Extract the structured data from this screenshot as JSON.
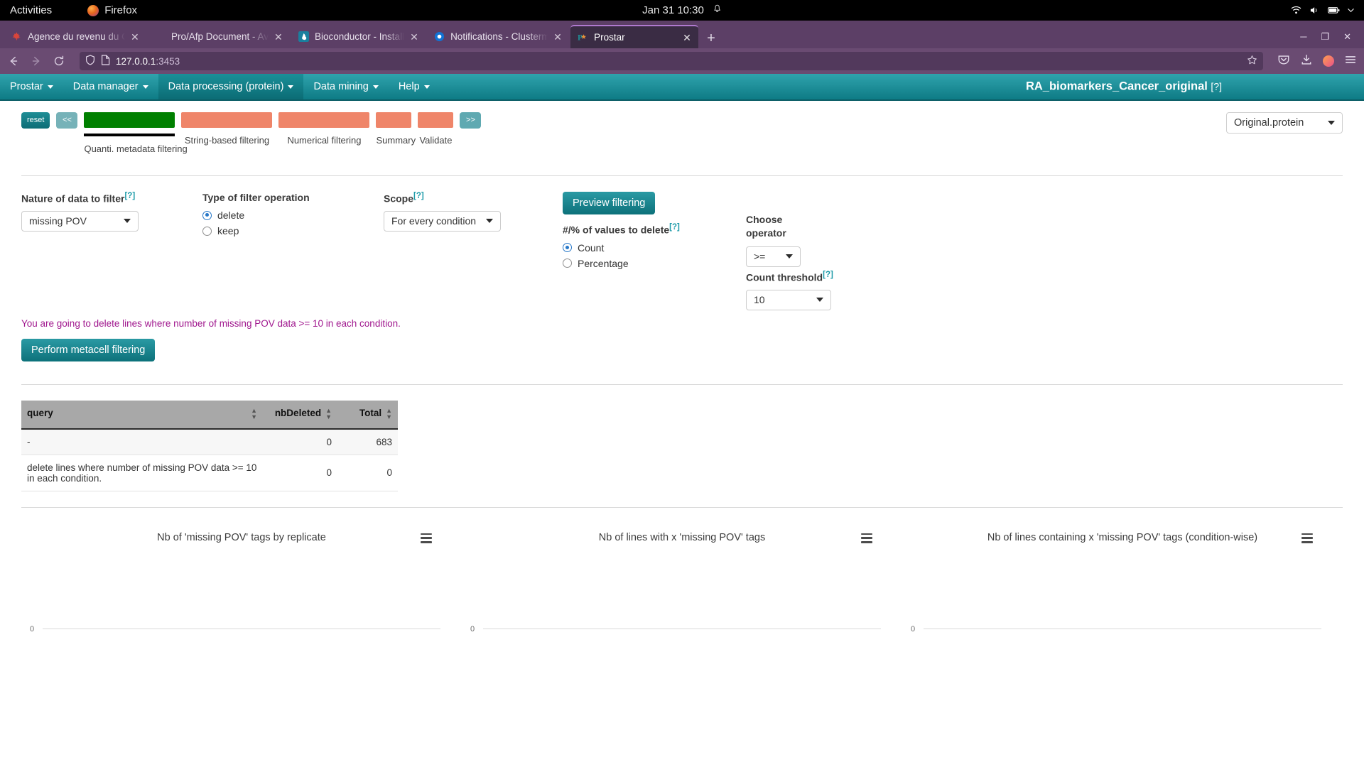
{
  "desktop": {
    "activities": "Activities",
    "app_name": "Firefox",
    "clock": "Jan 31  10:30",
    "icons": [
      "bell-icon",
      "wifi-icon",
      "volume-icon",
      "battery-icon",
      "power-menu-icon"
    ]
  },
  "browser": {
    "tabs": [
      {
        "title": "Agence du revenu du Can",
        "favicon": "maple-leaf-icon",
        "active": false
      },
      {
        "title": "Pro/Afp Document - Avis_de",
        "favicon": "blank-icon",
        "active": false
      },
      {
        "title": "Bioconductor - Install",
        "favicon": "bioconductor-icon",
        "active": false
      },
      {
        "title": "Notifications - Clusterma",
        "favicon": "notification-icon",
        "active": false
      },
      {
        "title": "Prostar",
        "favicon": "prostar-icon",
        "active": true
      }
    ],
    "new_tab_label": "+",
    "url_host": "127.0.0.1",
    "url_port": ":3453",
    "nav": {
      "back": "back-icon",
      "forward": "forward-icon",
      "reload": "reload-icon",
      "shield": "shield-icon",
      "page": "page-icon",
      "bookmark": "star-icon",
      "pocket": "pocket-icon",
      "downloads": "download-icon",
      "account": "account-icon",
      "menu": "hamburger-menu-icon"
    },
    "window_controls": {
      "minimize": "─",
      "maximize": "❐",
      "close": "✕"
    }
  },
  "app": {
    "menu": [
      {
        "label": "Prostar",
        "active": false
      },
      {
        "label": "Data manager",
        "active": false
      },
      {
        "label": "Data processing (protein)",
        "active": true
      },
      {
        "label": "Data mining",
        "active": false
      },
      {
        "label": "Help",
        "active": false
      }
    ],
    "dataset_title": "RA_biomarkers_Cancer_original",
    "dataset_title_help": "[?]",
    "dataset_select_value": "Original.protein"
  },
  "stepper": {
    "reset_label": "reset",
    "prev_label": "<<",
    "next_label": ">>",
    "steps": [
      {
        "label": "Quanti. metadata filtering",
        "state": "current",
        "color": "#008000"
      },
      {
        "label": "String-based filtering",
        "state": "todo",
        "color": "#ef8569"
      },
      {
        "label": "Numerical filtering",
        "state": "todo",
        "color": "#ef8569"
      },
      {
        "label": "Summary",
        "state": "todo",
        "color": "#ef8569"
      },
      {
        "label": "Validate",
        "state": "todo",
        "color": "#ef8569"
      }
    ]
  },
  "form": {
    "nature": {
      "label": "Nature of data to filter",
      "help": "[?]",
      "value": "missing POV"
    },
    "operation": {
      "label": "Type of filter operation",
      "options": [
        {
          "label": "delete",
          "checked": true
        },
        {
          "label": "keep",
          "checked": false
        }
      ]
    },
    "scope": {
      "label": "Scope",
      "help": "[?]",
      "value": "For every condition"
    },
    "preview_button": "Preview filtering",
    "values_to_delete": {
      "label": "#/% of values to delete",
      "help": "[?]",
      "options": [
        {
          "label": "Count",
          "checked": true
        },
        {
          "label": "Percentage",
          "checked": false
        }
      ]
    },
    "operator": {
      "label_line1": "Choose",
      "label_line2": "operator",
      "value": ">="
    },
    "threshold": {
      "label": "Count threshold",
      "help": "[?]",
      "value": "10"
    }
  },
  "message": {
    "warning": "You are going to delete lines where number of missing POV data >= 10 in each condition.",
    "perform_button": "Perform metacell filtering"
  },
  "table": {
    "headers": [
      "query",
      "nbDeleted",
      "Total"
    ],
    "rows": [
      {
        "query": "-",
        "nbDeleted": "0",
        "total": "683"
      },
      {
        "query": "delete lines where number of missing POV data >= 10 in each condition.",
        "nbDeleted": "0",
        "total": "0"
      }
    ]
  },
  "chart_data": [
    {
      "type": "bar",
      "title": "Nb of 'missing POV' tags by replicate",
      "categories": [],
      "values": [],
      "xlabel": "",
      "ylabel": "",
      "ylim": [
        0,
        0
      ],
      "tick_labels": [
        "0"
      ],
      "grid": false,
      "menu_icon": "hamburger-icon"
    },
    {
      "type": "bar",
      "title": "Nb of lines with x 'missing POV' tags",
      "categories": [],
      "values": [],
      "xlabel": "",
      "ylabel": "",
      "ylim": [
        0,
        0
      ],
      "tick_labels": [
        "0"
      ],
      "grid": false,
      "menu_icon": "hamburger-icon"
    },
    {
      "type": "bar",
      "title": "Nb of lines containing x 'missing POV' tags (condition-wise)",
      "categories": [],
      "values": [],
      "xlabel": "",
      "ylabel": "",
      "ylim": [
        0,
        0
      ],
      "tick_labels": [
        "0"
      ],
      "grid": false,
      "menu_icon": "hamburger-icon"
    }
  ],
  "colors": {
    "teal": "#0e7b85",
    "purple_chrome": "#6a4b72",
    "step_done": "#008000",
    "step_todo": "#ef8569",
    "warning_text": "#a0178e",
    "accent_help": "#1b9aa8"
  }
}
